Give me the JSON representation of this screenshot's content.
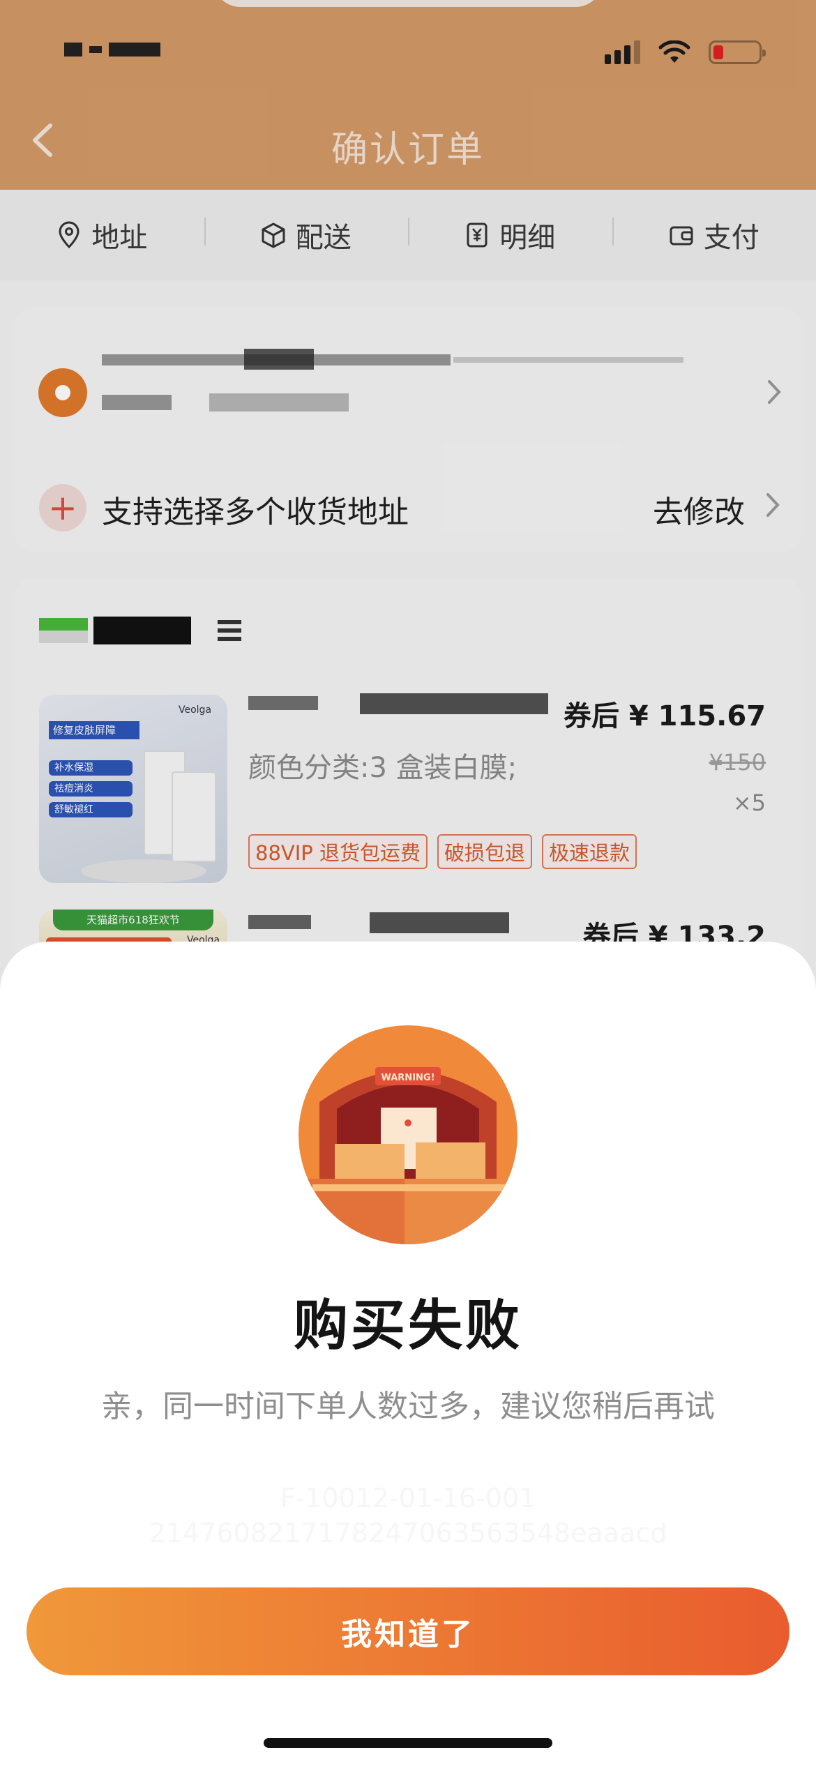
{
  "header": {
    "title": "确认订单"
  },
  "tabs": [
    {
      "label": "地址",
      "icon": "location-pin-icon"
    },
    {
      "label": "配送",
      "icon": "package-box-icon"
    },
    {
      "label": "明细",
      "icon": "yuan-receipt-icon"
    },
    {
      "label": "支付",
      "icon": "wallet-icon"
    }
  ],
  "address": {
    "multi_address_label": "支持选择多个收货地址",
    "edit_label": "去修改"
  },
  "goods": [
    {
      "price": "券后 ¥ 115.67",
      "spec": "颜色分类:3 盒装白膜;",
      "original_price": "¥150",
      "quantity": "×5",
      "badges": [
        "88VIP 退货包运费",
        "破损包退",
        "极速退款"
      ],
      "thumb_text": {
        "headline": "修复皮肤屏障",
        "bullets": [
          "补水保湿",
          "祛痘消炎",
          "舒敏褪红"
        ],
        "brand": "Veolga"
      }
    },
    {
      "price": "券后 ¥ 133.2",
      "thumb_text": {
        "banner": "天猫超市618狂欢节",
        "brand": "Veolga"
      }
    }
  ],
  "dialog": {
    "illustration_text": "WARNING!",
    "title": "购买失败",
    "message": "亲，同一时间下单人数过多，建议您稍后再试",
    "error_code": "F-10012-01-16-001",
    "trace_id": "2147608217178247063563548eaaacd",
    "confirm_label": "我知道了"
  },
  "colors": {
    "header_bg": "#d49a68",
    "accent_orange": "#e95c2e",
    "button_gradient_start": "#f0983a",
    "button_gradient_end": "#e95c2e",
    "badge_text": "#d65a2e",
    "battery_low": "#e02020"
  }
}
